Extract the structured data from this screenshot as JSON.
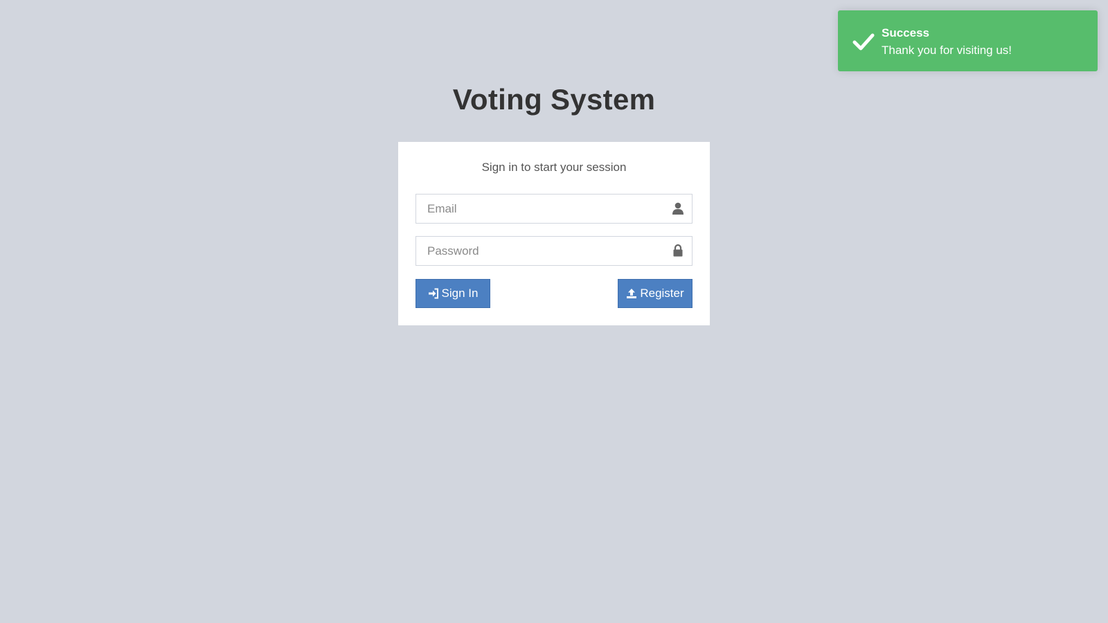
{
  "toast": {
    "type": "success",
    "title": "Success",
    "message": "Thank you for visiting us!",
    "icon": "check-icon",
    "color": "#57bd6c"
  },
  "page": {
    "title": "Voting System",
    "background": "#d2d6de"
  },
  "login": {
    "subtitle": "Sign in to start your session",
    "email": {
      "placeholder": "Email",
      "value": "",
      "icon": "user-icon"
    },
    "password": {
      "placeholder": "Password",
      "value": "",
      "icon": "lock-icon"
    },
    "signin_label": "Sign In",
    "signin_icon": "sign-in-icon",
    "register_label": "Register",
    "register_icon": "upload-icon",
    "button_color": "#4c80c2"
  }
}
